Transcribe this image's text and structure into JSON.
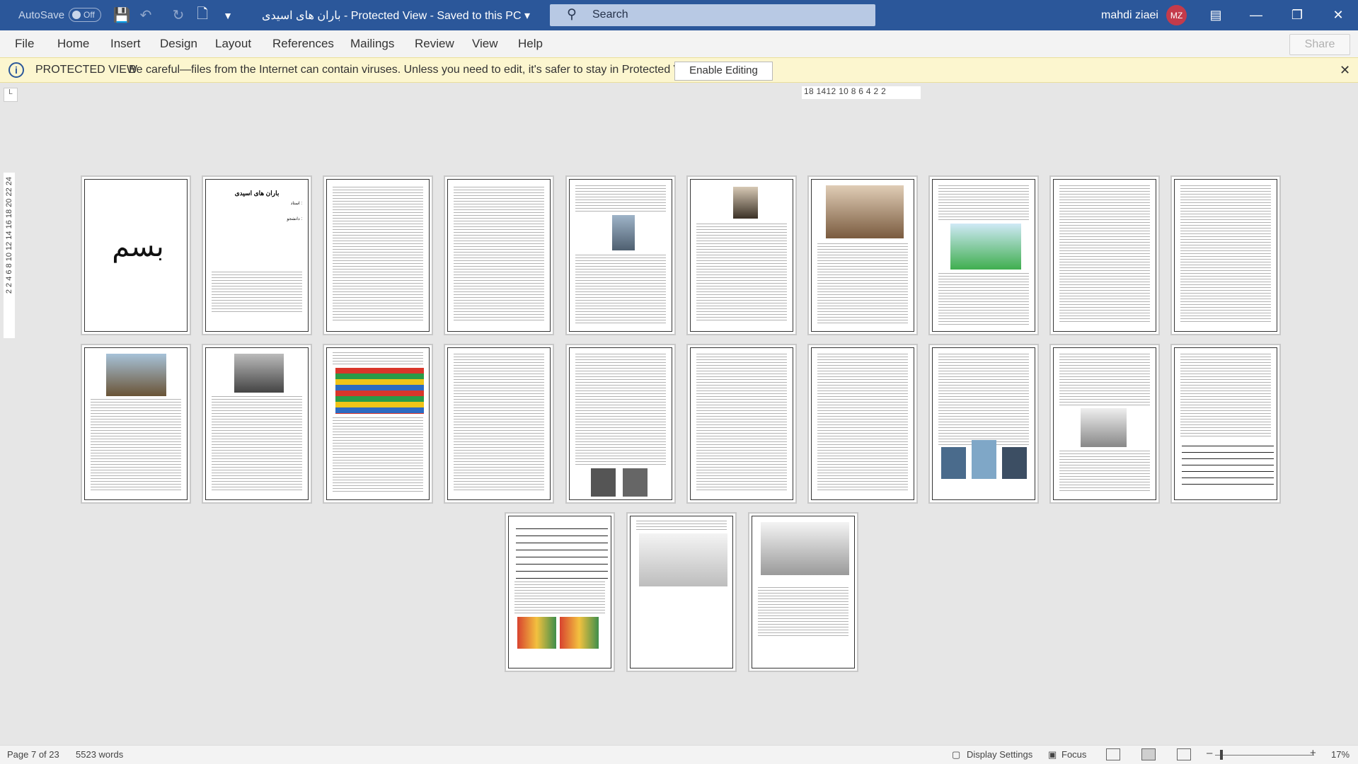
{
  "titlebar": {
    "autosave_label": "AutoSave",
    "autosave_state": "Off",
    "doc_title": "باران های اسیدی  -  Protected View  -  Saved to this PC  ▾",
    "search_placeholder": "Search",
    "user_name": "mahdi ziaei",
    "user_initials": "MZ"
  },
  "menu": {
    "items": [
      "File",
      "Home",
      "Insert",
      "Design",
      "Layout",
      "References",
      "Mailings",
      "Review",
      "View",
      "Help"
    ],
    "share_label": "Share"
  },
  "protected_view": {
    "title": "PROTECTED VIEW",
    "message": "Be careful—files from the Internet can contain viruses. Unless you need to edit, it's safer to stay in Protected View.",
    "button": "Enable Editing"
  },
  "ruler": {
    "horizontal_text": "18  1412 10  8   6   4   2    2",
    "vertical_text": "2  2  4  6  8 10 12 14 16 18 20 22 24"
  },
  "pages": {
    "cover_title": "باران های اسیدی",
    "cover_teacher": "استاد :",
    "cover_student": "دانشجو :"
  },
  "status": {
    "page_info": "Page 7 of 23",
    "word_count": "5523 words",
    "display_settings": "Display Settings",
    "focus": "Focus",
    "zoom": "17%"
  }
}
